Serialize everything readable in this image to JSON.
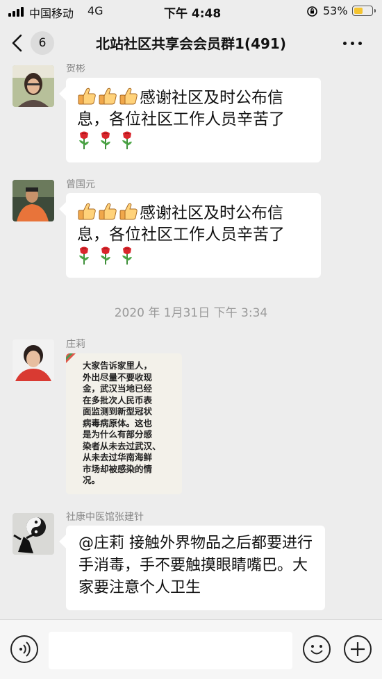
{
  "status_bar": {
    "carrier": "中国移动",
    "network": "4G",
    "time": "下午 4:48",
    "battery_percent": "53%",
    "battery_level": 0.53
  },
  "nav": {
    "unread_count": "6",
    "title": "北站社区共享会会员群1(491)"
  },
  "messages": [
    {
      "sender": "贺彬",
      "text": "感谢社区及时公布信息，各位社区工作人员辛苦了",
      "thumbs": 3,
      "roses": 3
    },
    {
      "sender": "曾国元",
      "text": "感谢社区及时公布信息，各位社区工作人员辛苦了",
      "thumbs": 3,
      "roses": 3
    },
    {
      "sender": "庄莉",
      "image_text": "大家告诉家里人，\n外出尽量不要收现\n金，武汉当地已经\n在多批次人民币表\n面监测到新型冠状\n病毒病原体。这也\n是为什么有部分感\n染者从未去过武汉、\n从未去过华南海鲜\n市场却被感染的情\n况。"
    },
    {
      "sender": "社康中医馆张建针",
      "text": "@庄莉 接触外界物品之后都要进行手消毒，手不要触摸眼睛嘴巴。大家要注意个人卫生"
    }
  ],
  "timestamp": "2020 年 1月31日  下午 3:34",
  "icons": {
    "back": "chevron-left-icon",
    "more": "more-dots-icon",
    "voice": "voice-icon",
    "emoji": "emoji-icon",
    "add": "plus-icon"
  },
  "colors": {
    "background": "#ededed",
    "bubble": "#ffffff",
    "meta_text": "#999999"
  }
}
